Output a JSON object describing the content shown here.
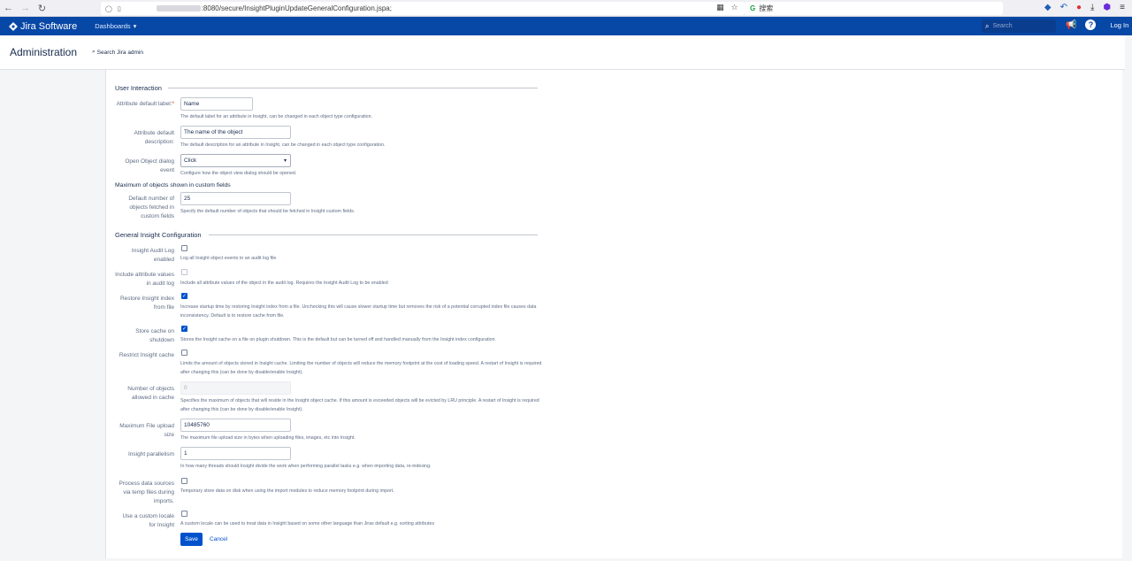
{
  "browser": {
    "back_icon": "←",
    "forward_icon": "→",
    "reload_icon": "↻",
    "url_prefix": "",
    "url": ":8080/secure/InsightPluginUpdateGeneralConfiguration.jspa;",
    "search_placeholder": "搜索",
    "star_icon": "☆"
  },
  "header": {
    "logo_text": "Jira Software",
    "dashboards_label": "Dashboards",
    "search_placeholder": "Search",
    "login_label": "Log In",
    "help_glyph": "?"
  },
  "admin": {
    "title": "Administration",
    "search_label": "Search Jira admin"
  },
  "sections": {
    "user_interaction": "User Interaction",
    "max_objects": "Maximum of objects shown in custom fields",
    "general": "General Insight Configuration"
  },
  "fields": {
    "attr_label": {
      "label": "Attribute default label:",
      "required": "*",
      "value": "Name",
      "desc": "The default label for an attribute in Insight, can be changed in each object type configuration."
    },
    "attr_desc": {
      "label": "Attribute default description:",
      "value": "The name of the object",
      "desc": "The default description for an attribute in Insight, can be changed in each object type configuration."
    },
    "open_dialog": {
      "label": "Open Object dialog event",
      "value": "Click",
      "desc": "Configure how the object view dialog should be opened."
    },
    "default_number": {
      "label": "Default number of objects fetched in custom fields",
      "value": "25",
      "desc": "Specify the default number of objects that should be fetched in Insight custom fields."
    },
    "audit_log": {
      "label": "Insight Audit Log enabled",
      "checked": false,
      "desc": "Log all Insight object events to an audit log file"
    },
    "include_attr": {
      "label": "Include attribute values in audit log",
      "checked": false,
      "desc": "Include all attribute values of the object in the audit log. Requires the Insight Audit Log to be enabled"
    },
    "restore_index": {
      "label": "Restore Insight index from file",
      "checked": true,
      "desc": "Increase startup time by restoring Insight index from a file. Unchecking this will cause slower startup time but removes the risk of a potential corrupted index file causes data inconsistency. Default is to restore cache from file."
    },
    "store_cache": {
      "label": "Store cache on shutdown",
      "checked": true,
      "desc": "Stores the Insight cache on a file on plugin shutdown. This is the default but can be turned off and handled manually from the Insight index configuration"
    },
    "restrict_cache": {
      "label": "Restrict Insight cache",
      "checked": false,
      "desc": "Limits the amount of objects stored in Insight cache. Limiting the number of objects will reduce the memory footprint at the cost of loading speed. A restart of Insight is required after changing this (can be done by disable/enable Insight)."
    },
    "number_allowed": {
      "label": "Number of objects allowed in cache",
      "value": "0",
      "desc": "Specifies the maximum of objects that will reside in the Insight object cache. If this amount is exceeded objects will be evicted by LRU principle. A restart of Insight is required after changing this (can be done by disable/enable Insight)."
    },
    "max_upload": {
      "label": "Maximum File upload size",
      "value": "10485760",
      "desc": "The maximum file upload size in bytes when uploading files, images, etc into Insight."
    },
    "parallelism": {
      "label": "Insight parallelism",
      "value": "1",
      "desc": "In how many threads should Insight divide the work when performing parallel tasks e.g. when importing data, re-indexing."
    },
    "temp_files": {
      "label": "Process data sources via temp files during imports.",
      "checked": false,
      "desc": "Temporary store data on disk when using the import modules to reduce memory footprint during import."
    },
    "custom_locale": {
      "label": "Use a custom locale for Insight",
      "checked": false,
      "desc": "A custom locale can be used to treat data in Insight based on some other language than Jiras default e.g. sorting attributes"
    }
  },
  "buttons": {
    "save": "Save",
    "cancel": "Cancel"
  },
  "colors": {
    "jira_blue": "#0747a6",
    "primary": "#0052cc"
  }
}
